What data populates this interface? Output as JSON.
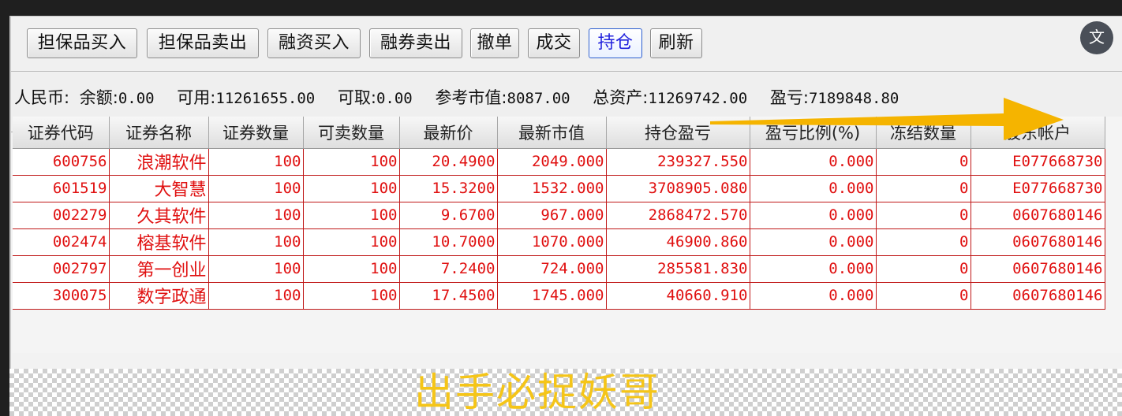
{
  "toolbar": {
    "buttons": [
      "担保品买入",
      "担保品卖出",
      "融资买入",
      "融券卖出",
      "撤单",
      "成交",
      "持仓",
      "刷新"
    ],
    "active": "持仓"
  },
  "info": {
    "currency": "人民币:",
    "balance_label": "余额:",
    "balance": "0.00",
    "available_label": "可用:",
    "available": "11261655.00",
    "withdrawable_label": "可取:",
    "withdrawable": "0.00",
    "ref_value_label": "参考市值:",
    "ref_value": "8087.00",
    "total_assets_label": "总资产:",
    "total_assets": "11269742.00",
    "pnl_label": "盈亏:",
    "pnl": "7189848.80"
  },
  "table": {
    "headers": [
      "证券代码",
      "证券名称",
      "证券数量",
      "可卖数量",
      "最新价",
      "最新市值",
      "持仓盈亏",
      "盈亏比例(%)",
      "冻结数量",
      "股东帐户"
    ],
    "rows": [
      [
        "600756",
        "浪潮软件",
        "100",
        "100",
        "20.4900",
        "2049.000",
        "239327.550",
        "0.000",
        "0",
        "E077668730"
      ],
      [
        "601519",
        "大智慧",
        "100",
        "100",
        "15.3200",
        "1532.000",
        "3708905.080",
        "0.000",
        "0",
        "E077668730"
      ],
      [
        "002279",
        "久其软件",
        "100",
        "100",
        "9.6700",
        "967.000",
        "2868472.570",
        "0.000",
        "0",
        "0607680146"
      ],
      [
        "002474",
        "榕基软件",
        "100",
        "100",
        "10.7000",
        "1070.000",
        "46900.860",
        "0.000",
        "0",
        "0607680146"
      ],
      [
        "002797",
        "第一创业",
        "100",
        "100",
        "7.2400",
        "724.000",
        "285581.830",
        "0.000",
        "0",
        "0607680146"
      ],
      [
        "300075",
        "数字政通",
        "100",
        "100",
        "17.4500",
        "1745.000",
        "40660.910",
        "0.000",
        "0",
        "0607680146"
      ]
    ]
  },
  "caption": "出手必捉妖哥",
  "translate_icon": "文",
  "colors": {
    "row_text": "#e01010",
    "active_button": "#2222dd",
    "arrow": "#f5b400",
    "caption": "#f5c518"
  }
}
